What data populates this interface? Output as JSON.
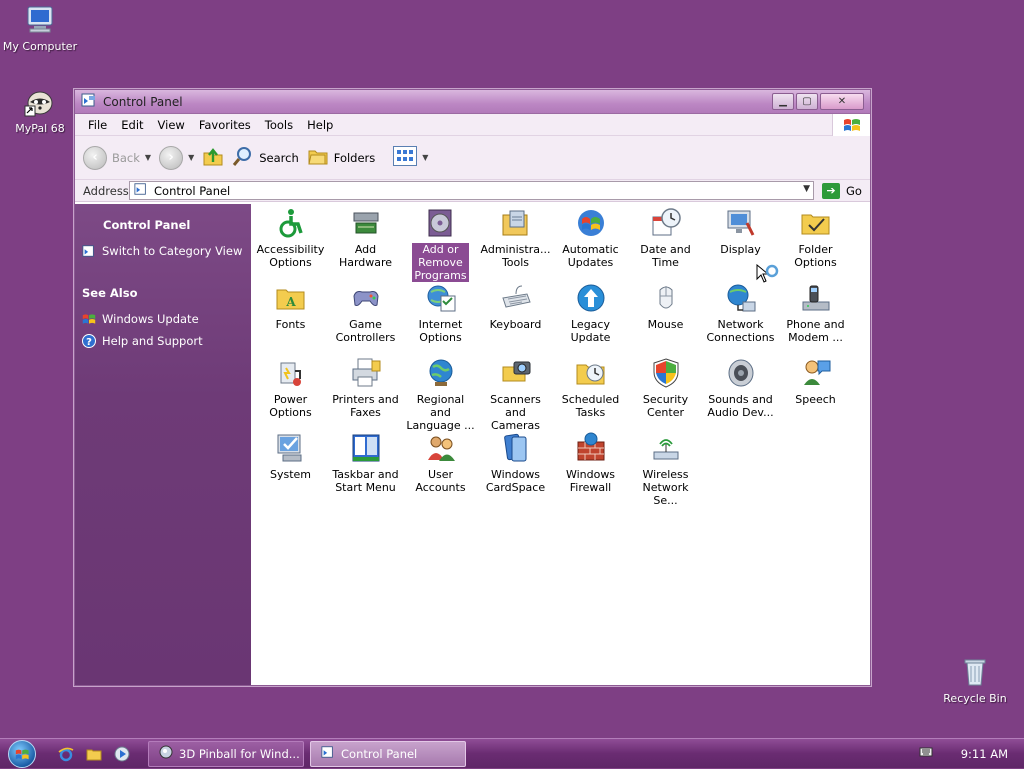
{
  "desktop": {
    "icons": [
      {
        "label": "My Computer"
      },
      {
        "label": "MyPal 68"
      },
      {
        "label": "Recycle Bin"
      }
    ]
  },
  "window": {
    "title": "Control Panel",
    "menu": [
      "File",
      "Edit",
      "View",
      "Favorites",
      "Tools",
      "Help"
    ],
    "toolbar": {
      "back": "Back",
      "search": "Search",
      "folders": "Folders"
    },
    "address": {
      "label": "Address",
      "value": "Control Panel",
      "go": "Go"
    },
    "sidebar": {
      "heading": "Control Panel",
      "switch_link": "Switch to Category View",
      "see_also": "See Also",
      "links": [
        "Windows Update",
        "Help and Support"
      ]
    },
    "items": [
      {
        "line1": "Accessibility",
        "line2": "Options",
        "icon": "accessibility-icon"
      },
      {
        "line1": "Add",
        "line2": "Hardware",
        "icon": "add-hardware-icon"
      },
      {
        "line1": "Add or",
        "line2": "Remove",
        "line3": "Programs",
        "icon": "add-remove-programs-icon",
        "selected": true
      },
      {
        "line1": "Administra...",
        "line2": "Tools",
        "icon": "administrative-tools-icon"
      },
      {
        "line1": "Automatic",
        "line2": "Updates",
        "icon": "automatic-updates-icon"
      },
      {
        "line1": "Date and",
        "line2": "Time",
        "icon": "date-time-icon"
      },
      {
        "line1": "Display",
        "line2": "",
        "icon": "display-icon"
      },
      {
        "line1": "Folder",
        "line2": "Options",
        "icon": "folder-options-icon"
      },
      {
        "line1": "Fonts",
        "line2": "",
        "icon": "fonts-icon"
      },
      {
        "line1": "Game",
        "line2": "Controllers",
        "icon": "game-controllers-icon"
      },
      {
        "line1": "Internet",
        "line2": "Options",
        "icon": "internet-options-icon"
      },
      {
        "line1": "Keyboard",
        "line2": "",
        "icon": "keyboard-icon"
      },
      {
        "line1": "Legacy",
        "line2": "Update",
        "icon": "legacy-update-icon"
      },
      {
        "line1": "Mouse",
        "line2": "",
        "icon": "mouse-icon"
      },
      {
        "line1": "Network",
        "line2": "Connections",
        "icon": "network-connections-icon"
      },
      {
        "line1": "Phone and",
        "line2": "Modem ...",
        "icon": "phone-modem-icon"
      },
      {
        "line1": "Power",
        "line2": "Options",
        "icon": "power-options-icon"
      },
      {
        "line1": "Printers and",
        "line2": "Faxes",
        "icon": "printers-faxes-icon"
      },
      {
        "line1": "Regional and",
        "line2": "Language ...",
        "icon": "regional-language-icon"
      },
      {
        "line1": "Scanners and",
        "line2": "Cameras",
        "icon": "scanners-cameras-icon"
      },
      {
        "line1": "Scheduled",
        "line2": "Tasks",
        "icon": "scheduled-tasks-icon"
      },
      {
        "line1": "Security",
        "line2": "Center",
        "icon": "security-center-icon"
      },
      {
        "line1": "Sounds and",
        "line2": "Audio Dev...",
        "icon": "sounds-audio-icon"
      },
      {
        "line1": "Speech",
        "line2": "",
        "icon": "speech-icon"
      },
      {
        "line1": "System",
        "line2": "",
        "icon": "system-icon"
      },
      {
        "line1": "Taskbar and",
        "line2": "Start Menu",
        "icon": "taskbar-start-menu-icon"
      },
      {
        "line1": "User",
        "line2": "Accounts",
        "icon": "user-accounts-icon"
      },
      {
        "line1": "Windows",
        "line2": "CardSpace",
        "icon": "windows-cardspace-icon"
      },
      {
        "line1": "Windows",
        "line2": "Firewall",
        "icon": "windows-firewall-icon"
      },
      {
        "line1": "Wireless",
        "line2": "Network Se...",
        "icon": "wireless-network-icon"
      }
    ]
  },
  "taskbar": {
    "tasks": [
      "3D Pinball for Wind...",
      "Control Panel"
    ],
    "clock": "9:11 AM"
  },
  "colors": {
    "desktop": "#7e3f84",
    "sidebar": "#6e3b77",
    "selection": "#8b4b93"
  }
}
